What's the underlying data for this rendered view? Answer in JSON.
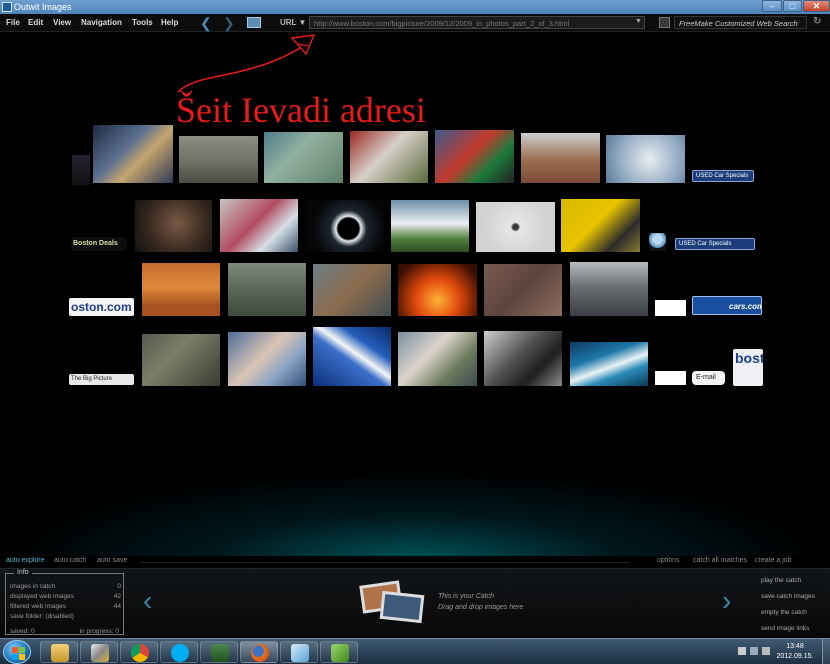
{
  "window": {
    "title": "Outwit Images",
    "minimize_glyph": "–",
    "maximize_glyph": "□",
    "close_glyph": "✕"
  },
  "menu": {
    "items": [
      "File",
      "Edit",
      "View",
      "Navigation",
      "Tools",
      "Help"
    ]
  },
  "nav": {
    "back_icon": "back-arrow-icon",
    "forward_icon": "forward-arrow-icon",
    "url_label": "URL ▼",
    "url_value": "http://www.boston.com/bigpicture/2009/12/2009_in_photos_part_2_of_3.html",
    "search_value": "FreeMake Customized Web Search"
  },
  "annotation": {
    "text": "Šeit Ievadi adresi",
    "color": "#e81a1a"
  },
  "image_wall": {
    "ads": {
      "used_car_1": "USED Car Specials",
      "used_car_2": "USED Car Specials",
      "boston_deals": "Boston Deals",
      "boston_com": "oston.com",
      "cars_com": "cars.com",
      "big_picture": "The Big Picture",
      "email": "E-mail",
      "boston_partial": "bost"
    }
  },
  "bottom_toolbar": {
    "auto_explore": "auto explore",
    "auto_catch": "auto catch",
    "auto_save": "auto save",
    "options": "options",
    "catch_all": "catch all matches",
    "create_job": "create a job"
  },
  "info": {
    "title": "Info",
    "rows": [
      {
        "label": "images in catch",
        "value": "0"
      },
      {
        "label": "displayed web images",
        "value": "42"
      },
      {
        "label": "filtered web images",
        "value": "44"
      },
      {
        "label": "save folder:  (disabled)",
        "value": ""
      }
    ],
    "saved": "saved:  0",
    "in_progress": "in progress:  0"
  },
  "catch": {
    "line1": "This is your Catch",
    "line2": "Drag and drop images here",
    "actions": [
      "play the catch",
      "save catch images",
      "empty the catch",
      "send image links"
    ]
  },
  "taskbar": {
    "time": "13:48",
    "date": "2012.09.15."
  }
}
